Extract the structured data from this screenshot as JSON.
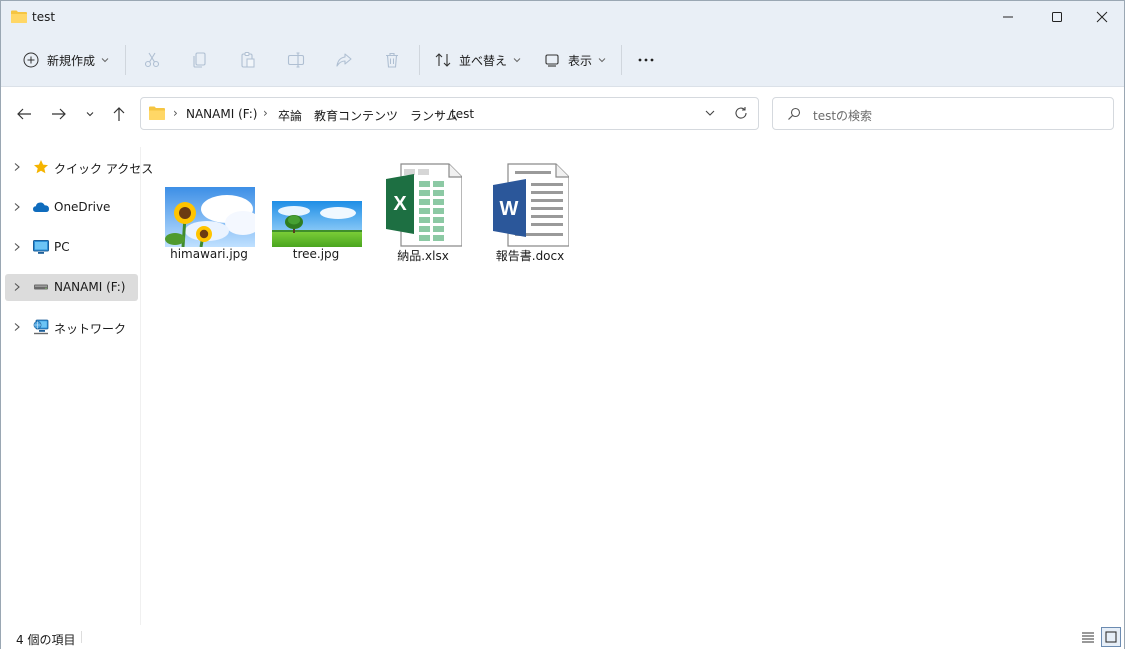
{
  "window": {
    "title": "test",
    "icons": {
      "folder": "folder-icon",
      "minimize": "minimize-icon",
      "maximize": "maximize-icon",
      "close": "close-icon"
    }
  },
  "toolbar": {
    "new_label": "新規作成",
    "sort_label": "並べ替え",
    "view_label": "表示",
    "icons": [
      "add-circle-icon",
      "cut-icon",
      "copy-icon",
      "paste-icon",
      "rename-icon",
      "share-icon",
      "delete-icon",
      "sort-icon",
      "view-icon",
      "more-icon"
    ]
  },
  "address": {
    "crumbs": [
      "NANAMI (F:)",
      "卒論　教育コンテンツ　ランサム",
      "test"
    ]
  },
  "search": {
    "placeholder": "testの検索"
  },
  "sidebar": {
    "items": [
      {
        "label": "クイック アクセス",
        "icon": "star-icon"
      },
      {
        "label": "OneDrive",
        "icon": "cloud-icon"
      },
      {
        "label": "PC",
        "icon": "monitor-icon"
      },
      {
        "label": "NANAMI (F:)",
        "icon": "drive-icon",
        "selected": true
      },
      {
        "label": "ネットワーク",
        "icon": "network-icon"
      }
    ]
  },
  "files": [
    {
      "name": "himawari.jpg",
      "type": "image"
    },
    {
      "name": "tree.jpg",
      "type": "image"
    },
    {
      "name": "納品.xlsx",
      "type": "excel"
    },
    {
      "name": "報告書.docx",
      "type": "word"
    }
  ],
  "status": {
    "item_count": "4 個の項目"
  },
  "colors": {
    "chrome": "#e9eff6",
    "folder": "#f5c542",
    "excel": "#1d6f42",
    "word": "#2b579a",
    "selected": "#dcdcdc"
  }
}
